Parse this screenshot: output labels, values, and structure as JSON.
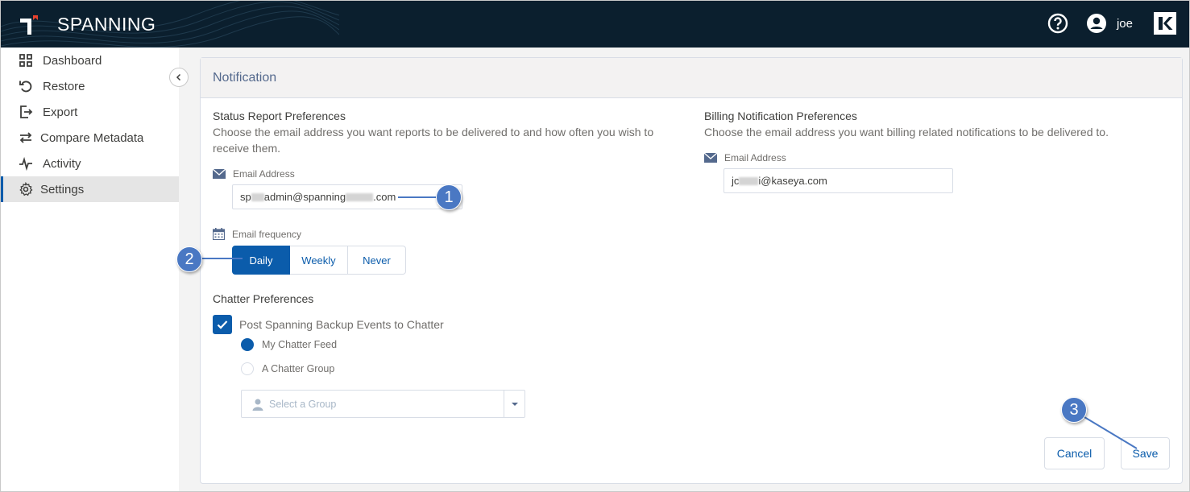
{
  "app": {
    "brand": "SPANNING",
    "user_name": "joe"
  },
  "colors": {
    "header_bg": "#0b1f2e",
    "accent": "#0b5cab",
    "callout": "#4a78c3",
    "logo_red": "#e8432e"
  },
  "sidebar": {
    "items": [
      {
        "label": "Dashboard",
        "icon": "grid-icon"
      },
      {
        "label": "Restore",
        "icon": "restore-icon"
      },
      {
        "label": "Export",
        "icon": "export-icon"
      },
      {
        "label": "Compare Metadata",
        "icon": "compare-icon"
      },
      {
        "label": "Activity",
        "icon": "activity-icon"
      },
      {
        "label": "Settings",
        "icon": "gear-icon",
        "active": true
      }
    ]
  },
  "card": {
    "title": "Notification"
  },
  "status_report": {
    "title": "Status Report Preferences",
    "description": "Choose the email address you want reports to be delivered to and how often you wish to receive them.",
    "email_label": "Email Address",
    "email_prefix": "sp",
    "email_mid": "admin@spanning",
    "email_suffix": ".com",
    "frequency_label": "Email frequency",
    "frequency_options": [
      "Daily",
      "Weekly",
      "Never"
    ],
    "frequency_selected": "Daily"
  },
  "billing": {
    "title": "Billing Notification Preferences",
    "description": "Choose the email address you want billing related notifications to be delivered to.",
    "email_label": "Email Address",
    "email_prefix": "jc",
    "email_suffix": "i@kaseya.com"
  },
  "chatter": {
    "title": "Chatter Preferences",
    "checkbox_label": "Post Spanning Backup Events to Chatter",
    "checked": true,
    "options": [
      "My Chatter Feed",
      "A Chatter Group"
    ],
    "selected_option": "My Chatter Feed",
    "group_placeholder": "Select a Group"
  },
  "actions": {
    "cancel": "Cancel",
    "save": "Save"
  },
  "callouts": [
    "1",
    "2",
    "3"
  ]
}
